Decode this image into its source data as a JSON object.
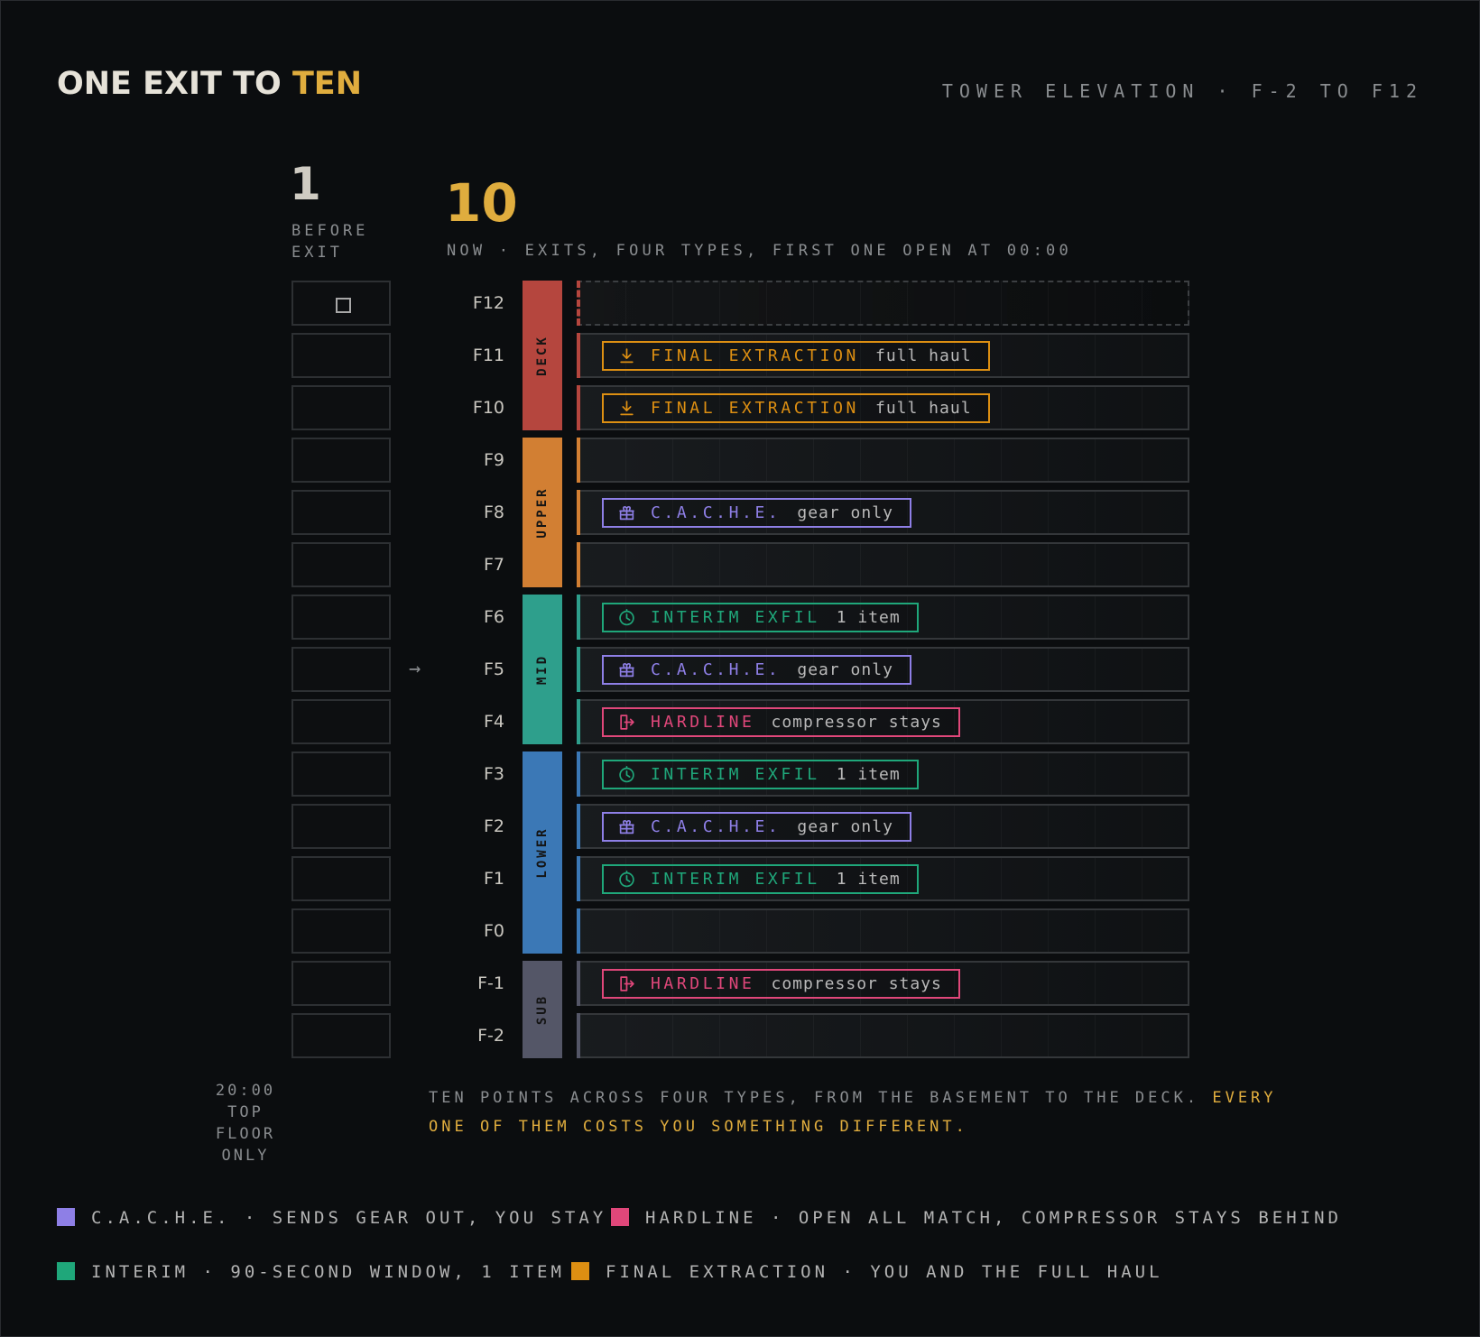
{
  "header": {
    "title_prefix": "ONE EXIT TO",
    "title_highlight": "TEN",
    "subtitle": "TOWER ELEVATION · F-2 TO F12"
  },
  "stats": {
    "before_value": "1",
    "before_caption": "BEFORE EXIT",
    "now_value": "10",
    "now_caption": "NOW · EXITS, FOUR TYPES, FIRST ONE OPEN AT 00:00"
  },
  "colors": {
    "cache": "#8e7fe6",
    "hardline": "#e0477a",
    "interim": "#1fa77a",
    "final": "#dd8f12",
    "deck": "#b5463e",
    "upper": "#d27f33",
    "mid": "#2e9f8c",
    "lower": "#3b78b6",
    "sub": "#545667",
    "accent": "#e0ad3e"
  },
  "exit_types": {
    "final": {
      "name": "FINAL EXTRACTION",
      "note": "full haul",
      "icon": "download-icon"
    },
    "cache": {
      "name": "C.A.C.H.E.",
      "note": "gear only",
      "icon": "gift-box-icon"
    },
    "interim": {
      "name": "INTERIM EXFIL",
      "note": "1 item",
      "icon": "timer-icon"
    },
    "hardline": {
      "name": "HARDLINE",
      "note": "compressor stays",
      "icon": "exit-door-icon"
    }
  },
  "zones": [
    {
      "label": "DECK",
      "key": "deck",
      "floors": [
        "F12",
        "F11",
        "F10"
      ]
    },
    {
      "label": "UPPER",
      "key": "upper",
      "floors": [
        "F9",
        "F8",
        "F7"
      ]
    },
    {
      "label": "MID",
      "key": "mid",
      "floors": [
        "F6",
        "F5",
        "F4"
      ]
    },
    {
      "label": "LOWER",
      "key": "lower",
      "floors": [
        "F3",
        "F2",
        "F1",
        "F0"
      ]
    },
    {
      "label": "SUB",
      "key": "sub",
      "floors": [
        "F-1",
        "F-2"
      ]
    }
  ],
  "floors": [
    {
      "floor": "F12",
      "zone": "deck",
      "exit": null,
      "before_exit": true,
      "empty_top": true
    },
    {
      "floor": "F11",
      "zone": "deck",
      "exit": "final"
    },
    {
      "floor": "F10",
      "zone": "deck",
      "exit": "final"
    },
    {
      "floor": "F9",
      "zone": "upper",
      "exit": null
    },
    {
      "floor": "F8",
      "zone": "upper",
      "exit": "cache"
    },
    {
      "floor": "F7",
      "zone": "upper",
      "exit": null
    },
    {
      "floor": "F6",
      "zone": "mid",
      "exit": "interim"
    },
    {
      "floor": "F5",
      "zone": "mid",
      "exit": "cache",
      "arrow": "→"
    },
    {
      "floor": "F4",
      "zone": "mid",
      "exit": "hardline"
    },
    {
      "floor": "F3",
      "zone": "lower",
      "exit": "interim"
    },
    {
      "floor": "F2",
      "zone": "lower",
      "exit": "cache"
    },
    {
      "floor": "F1",
      "zone": "lower",
      "exit": "interim"
    },
    {
      "floor": "F0",
      "zone": "lower",
      "exit": null
    },
    {
      "floor": "F-1",
      "zone": "sub",
      "exit": "hardline"
    },
    {
      "floor": "F-2",
      "zone": "sub",
      "exit": null
    }
  ],
  "notes": {
    "top_floor": "20:00 TOP FLOOR ONLY",
    "summary_plain": "TEN POINTS ACROSS FOUR TYPES, FROM THE BASEMENT TO THE DECK.",
    "summary_highlight": "EVERY ONE OF THEM COSTS YOU SOMETHING DIFFERENT."
  },
  "legend": [
    {
      "key": "cache",
      "text": "C.A.C.H.E. · SENDS GEAR OUT, YOU STAY"
    },
    {
      "key": "hardline",
      "text": "HARDLINE · OPEN ALL MATCH, COMPRESSOR STAYS BEHIND"
    },
    {
      "key": "interim",
      "text": "INTERIM · 90-SECOND WINDOW, 1 ITEM"
    },
    {
      "key": "final",
      "text": "FINAL EXTRACTION · YOU AND THE FULL HAUL"
    }
  ]
}
